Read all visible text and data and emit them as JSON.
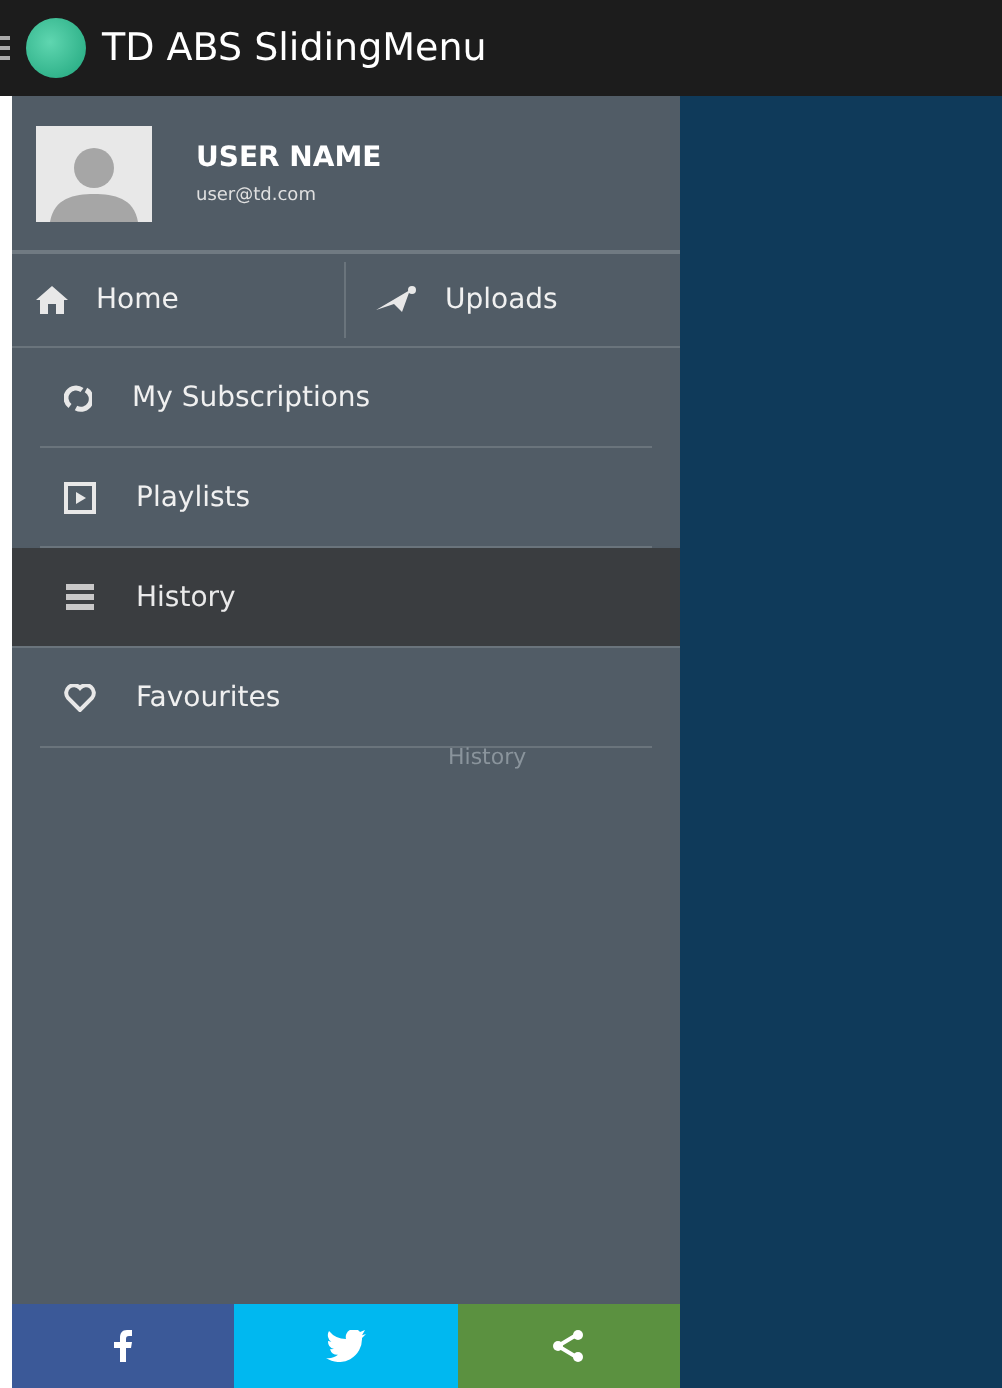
{
  "app_bar": {
    "title": "TD ABS SlidingMenu"
  },
  "profile": {
    "name": "USER NAME",
    "email": "user@td.com"
  },
  "quick_tabs": [
    {
      "label": "Home"
    },
    {
      "label": "Uploads"
    }
  ],
  "menu": [
    {
      "label": "My Subscriptions",
      "selected": false
    },
    {
      "label": "Playlists",
      "selected": false
    },
    {
      "label": "History",
      "selected": true
    },
    {
      "label": "Favourites",
      "selected": false
    }
  ],
  "ghost_label": "History",
  "share_bar": [
    {
      "kind": "facebook",
      "color": "#3b5998"
    },
    {
      "kind": "twitter",
      "color": "#00b8f0"
    },
    {
      "kind": "share",
      "color": "#5b9140"
    }
  ]
}
